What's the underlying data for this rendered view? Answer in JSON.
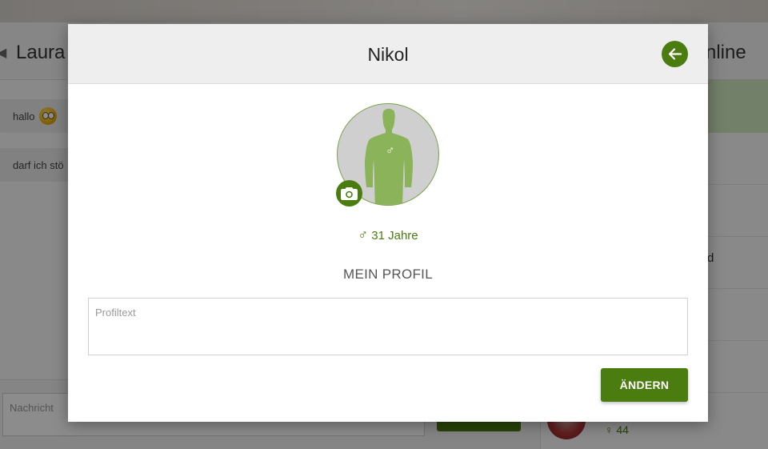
{
  "background": {
    "chat_title_fragment": "Laura",
    "online_fragment": "nline",
    "messages": [
      {
        "text": "hallo"
      },
      {
        "text": "darf ich stö"
      }
    ],
    "message_input_placeholder": "Nachricht",
    "right_list_fragment": "d",
    "right_list_age": "44",
    "right_list_gender_symbol": "♀"
  },
  "modal": {
    "title": "Nikol",
    "back_icon": "arrow-left-icon",
    "avatar_icon": "male-silhouette-icon",
    "camera_icon": "camera-icon",
    "gender_symbol": "♂",
    "age_text": "31 Jahre",
    "section_title": "MEIN PROFIL",
    "profile_placeholder": "Profiltext",
    "profile_value": "",
    "change_button_label": "ÄNDERN"
  },
  "colors": {
    "accent": "#4a7c10",
    "header_bg": "#eeeeee",
    "overlay": "rgba(0,0,0,0.45)",
    "silhouette": "#8ab35a"
  }
}
